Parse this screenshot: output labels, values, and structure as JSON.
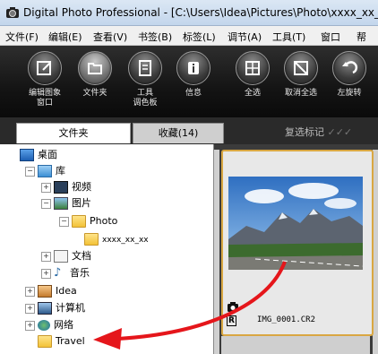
{
  "window": {
    "title": "Digital Photo Professional - [C:\\Users\\Idea\\Pictures\\Photo\\xxxx_xx_xx]"
  },
  "menu": [
    "文件(F)",
    "编辑(E)",
    "查看(V)",
    "书签(B)",
    "标签(L)",
    "调节(A)",
    "工具(T)",
    "窗口",
    "帮"
  ],
  "toolbar": {
    "buttons": [
      {
        "label": "编辑图象\n窗口",
        "icon": "edit-image-icon"
      },
      {
        "label": "文件夹",
        "icon": "folder-icon"
      },
      {
        "label": "工具\n调色板",
        "icon": "tool-palette-icon"
      },
      {
        "label": "信息",
        "icon": "info-icon"
      },
      {
        "label": "全选",
        "icon": "select-all-icon"
      },
      {
        "label": "取消全选",
        "icon": "deselect-all-icon"
      },
      {
        "label": "左旋转",
        "icon": "rotate-left-icon"
      }
    ]
  },
  "tabs": {
    "folder": "文件夹",
    "favorites": "收藏(14)",
    "filter": "复选标记"
  },
  "tree": {
    "desktop": "桌面",
    "library": "库",
    "video": "视频",
    "pictures": "图片",
    "photo": "Photo",
    "date_folder": "xxxx_xx_xx",
    "documents": "文档",
    "music": "音乐",
    "idea": "Idea",
    "computer": "计算机",
    "network": "网络",
    "travel": "Travel"
  },
  "viewer": {
    "file_name": "IMG_0001.CR2"
  },
  "colors": {
    "selection_border": "#d9a742",
    "arrow": "#e5161b"
  }
}
